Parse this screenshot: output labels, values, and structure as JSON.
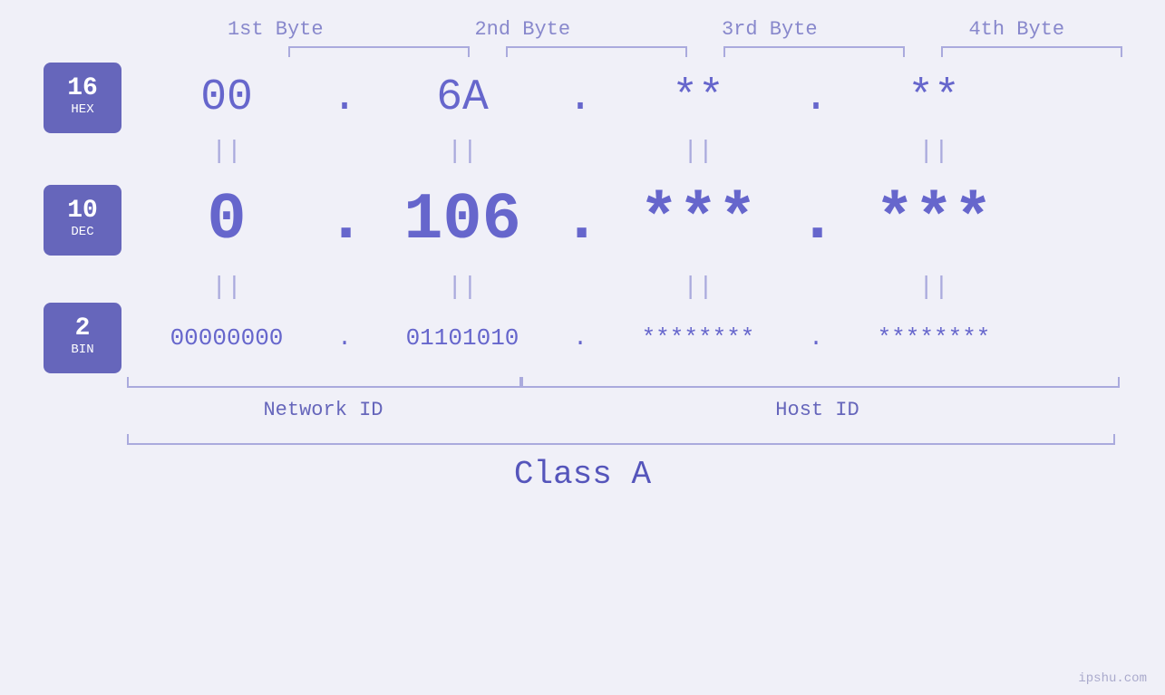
{
  "page": {
    "background": "#f0f0f8",
    "watermark": "ipshu.com"
  },
  "headers": {
    "byte1": "1st Byte",
    "byte2": "2nd Byte",
    "byte3": "3rd Byte",
    "byte4": "4th Byte"
  },
  "badges": {
    "hex": {
      "number": "16",
      "label": "HEX"
    },
    "dec": {
      "number": "10",
      "label": "DEC"
    },
    "bin": {
      "number": "2",
      "label": "BIN"
    }
  },
  "hex_row": {
    "b1": "00",
    "b2": "6A",
    "b3": "**",
    "b4": "**",
    "dot": "."
  },
  "dec_row": {
    "b1": "0",
    "b2": "106",
    "b3": "***",
    "b4": "***",
    "dot": "."
  },
  "bin_row": {
    "b1": "00000000",
    "b2": "01101010",
    "b3": "********",
    "b4": "********",
    "dot": "."
  },
  "equals": "||",
  "labels": {
    "network_id": "Network ID",
    "host_id": "Host ID",
    "class": "Class A"
  }
}
